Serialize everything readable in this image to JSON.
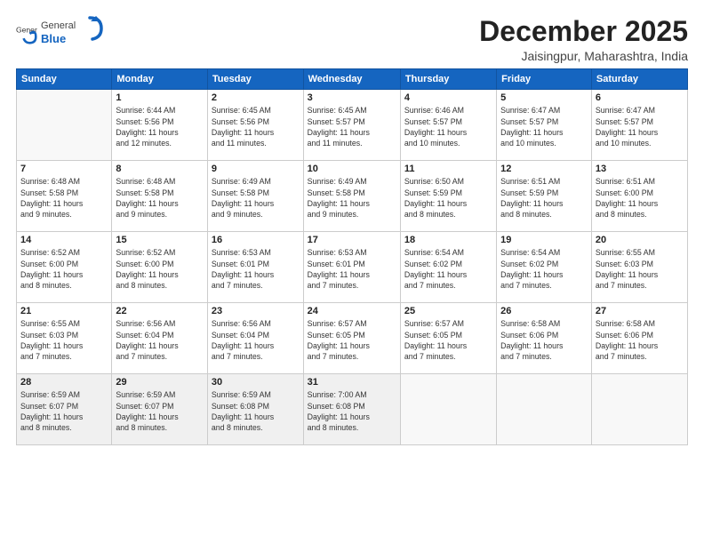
{
  "header": {
    "logo": {
      "general": "General",
      "blue": "Blue"
    },
    "title": "December 2025",
    "location": "Jaisingpur, Maharashtra, India"
  },
  "days_of_week": [
    "Sunday",
    "Monday",
    "Tuesday",
    "Wednesday",
    "Thursday",
    "Friday",
    "Saturday"
  ],
  "weeks": [
    [
      {
        "day": "",
        "info": ""
      },
      {
        "day": "1",
        "info": "Sunrise: 6:44 AM\nSunset: 5:56 PM\nDaylight: 11 hours\nand 12 minutes."
      },
      {
        "day": "2",
        "info": "Sunrise: 6:45 AM\nSunset: 5:56 PM\nDaylight: 11 hours\nand 11 minutes."
      },
      {
        "day": "3",
        "info": "Sunrise: 6:45 AM\nSunset: 5:57 PM\nDaylight: 11 hours\nand 11 minutes."
      },
      {
        "day": "4",
        "info": "Sunrise: 6:46 AM\nSunset: 5:57 PM\nDaylight: 11 hours\nand 10 minutes."
      },
      {
        "day": "5",
        "info": "Sunrise: 6:47 AM\nSunset: 5:57 PM\nDaylight: 11 hours\nand 10 minutes."
      },
      {
        "day": "6",
        "info": "Sunrise: 6:47 AM\nSunset: 5:57 PM\nDaylight: 11 hours\nand 10 minutes."
      }
    ],
    [
      {
        "day": "7",
        "info": "Sunrise: 6:48 AM\nSunset: 5:58 PM\nDaylight: 11 hours\nand 9 minutes."
      },
      {
        "day": "8",
        "info": "Sunrise: 6:48 AM\nSunset: 5:58 PM\nDaylight: 11 hours\nand 9 minutes."
      },
      {
        "day": "9",
        "info": "Sunrise: 6:49 AM\nSunset: 5:58 PM\nDaylight: 11 hours\nand 9 minutes."
      },
      {
        "day": "10",
        "info": "Sunrise: 6:49 AM\nSunset: 5:58 PM\nDaylight: 11 hours\nand 9 minutes."
      },
      {
        "day": "11",
        "info": "Sunrise: 6:50 AM\nSunset: 5:59 PM\nDaylight: 11 hours\nand 8 minutes."
      },
      {
        "day": "12",
        "info": "Sunrise: 6:51 AM\nSunset: 5:59 PM\nDaylight: 11 hours\nand 8 minutes."
      },
      {
        "day": "13",
        "info": "Sunrise: 6:51 AM\nSunset: 6:00 PM\nDaylight: 11 hours\nand 8 minutes."
      }
    ],
    [
      {
        "day": "14",
        "info": "Sunrise: 6:52 AM\nSunset: 6:00 PM\nDaylight: 11 hours\nand 8 minutes."
      },
      {
        "day": "15",
        "info": "Sunrise: 6:52 AM\nSunset: 6:00 PM\nDaylight: 11 hours\nand 8 minutes."
      },
      {
        "day": "16",
        "info": "Sunrise: 6:53 AM\nSunset: 6:01 PM\nDaylight: 11 hours\nand 7 minutes."
      },
      {
        "day": "17",
        "info": "Sunrise: 6:53 AM\nSunset: 6:01 PM\nDaylight: 11 hours\nand 7 minutes."
      },
      {
        "day": "18",
        "info": "Sunrise: 6:54 AM\nSunset: 6:02 PM\nDaylight: 11 hours\nand 7 minutes."
      },
      {
        "day": "19",
        "info": "Sunrise: 6:54 AM\nSunset: 6:02 PM\nDaylight: 11 hours\nand 7 minutes."
      },
      {
        "day": "20",
        "info": "Sunrise: 6:55 AM\nSunset: 6:03 PM\nDaylight: 11 hours\nand 7 minutes."
      }
    ],
    [
      {
        "day": "21",
        "info": "Sunrise: 6:55 AM\nSunset: 6:03 PM\nDaylight: 11 hours\nand 7 minutes."
      },
      {
        "day": "22",
        "info": "Sunrise: 6:56 AM\nSunset: 6:04 PM\nDaylight: 11 hours\nand 7 minutes."
      },
      {
        "day": "23",
        "info": "Sunrise: 6:56 AM\nSunset: 6:04 PM\nDaylight: 11 hours\nand 7 minutes."
      },
      {
        "day": "24",
        "info": "Sunrise: 6:57 AM\nSunset: 6:05 PM\nDaylight: 11 hours\nand 7 minutes."
      },
      {
        "day": "25",
        "info": "Sunrise: 6:57 AM\nSunset: 6:05 PM\nDaylight: 11 hours\nand 7 minutes."
      },
      {
        "day": "26",
        "info": "Sunrise: 6:58 AM\nSunset: 6:06 PM\nDaylight: 11 hours\nand 7 minutes."
      },
      {
        "day": "27",
        "info": "Sunrise: 6:58 AM\nSunset: 6:06 PM\nDaylight: 11 hours\nand 7 minutes."
      }
    ],
    [
      {
        "day": "28",
        "info": "Sunrise: 6:59 AM\nSunset: 6:07 PM\nDaylight: 11 hours\nand 8 minutes."
      },
      {
        "day": "29",
        "info": "Sunrise: 6:59 AM\nSunset: 6:07 PM\nDaylight: 11 hours\nand 8 minutes."
      },
      {
        "day": "30",
        "info": "Sunrise: 6:59 AM\nSunset: 6:08 PM\nDaylight: 11 hours\nand 8 minutes."
      },
      {
        "day": "31",
        "info": "Sunrise: 7:00 AM\nSunset: 6:08 PM\nDaylight: 11 hours\nand 8 minutes."
      },
      {
        "day": "",
        "info": ""
      },
      {
        "day": "",
        "info": ""
      },
      {
        "day": "",
        "info": ""
      }
    ]
  ]
}
